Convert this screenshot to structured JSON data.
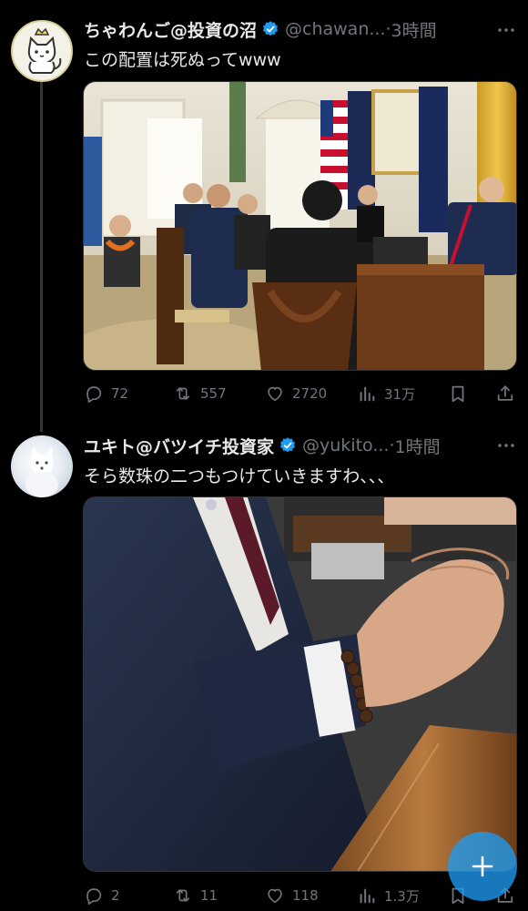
{
  "colors": {
    "background": "#000000",
    "text_primary": "#e7e9ea",
    "text_secondary": "#71767b",
    "verified_blue": "#1d9bf0",
    "thread_line": "#333639",
    "fab_blue": "#1d9bf0"
  },
  "tweets": [
    {
      "display_name": "ちゃわんご@投資の沼",
      "handle": "@chawan...",
      "dot": "·",
      "time": "3時間",
      "text": "この配置は死ぬってwww",
      "avatar_icon": "cat-illustration-avatar",
      "media_icon": "photo-oval-office-meeting",
      "stats": {
        "replies": "72",
        "reposts": "557",
        "likes": "2720",
        "views": "31万"
      }
    },
    {
      "display_name": "ユキト@バツイチ投資家",
      "handle": "@yukito...",
      "dot": "·",
      "time": "1時間",
      "text": "そら数珠の二つもつけていきますわ、、、",
      "avatar_icon": "white-fox-avatar",
      "media_icon": "photo-hands-with-bead-bracelet",
      "stats": {
        "replies": "2",
        "reposts": "11",
        "likes": "118",
        "views": "1.3万"
      }
    }
  ],
  "icons": [
    "verified-badge-icon",
    "more-icon",
    "reply-icon",
    "repost-icon",
    "like-icon",
    "views-icon",
    "bookmark-icon",
    "share-icon",
    "compose-plus-icon"
  ]
}
